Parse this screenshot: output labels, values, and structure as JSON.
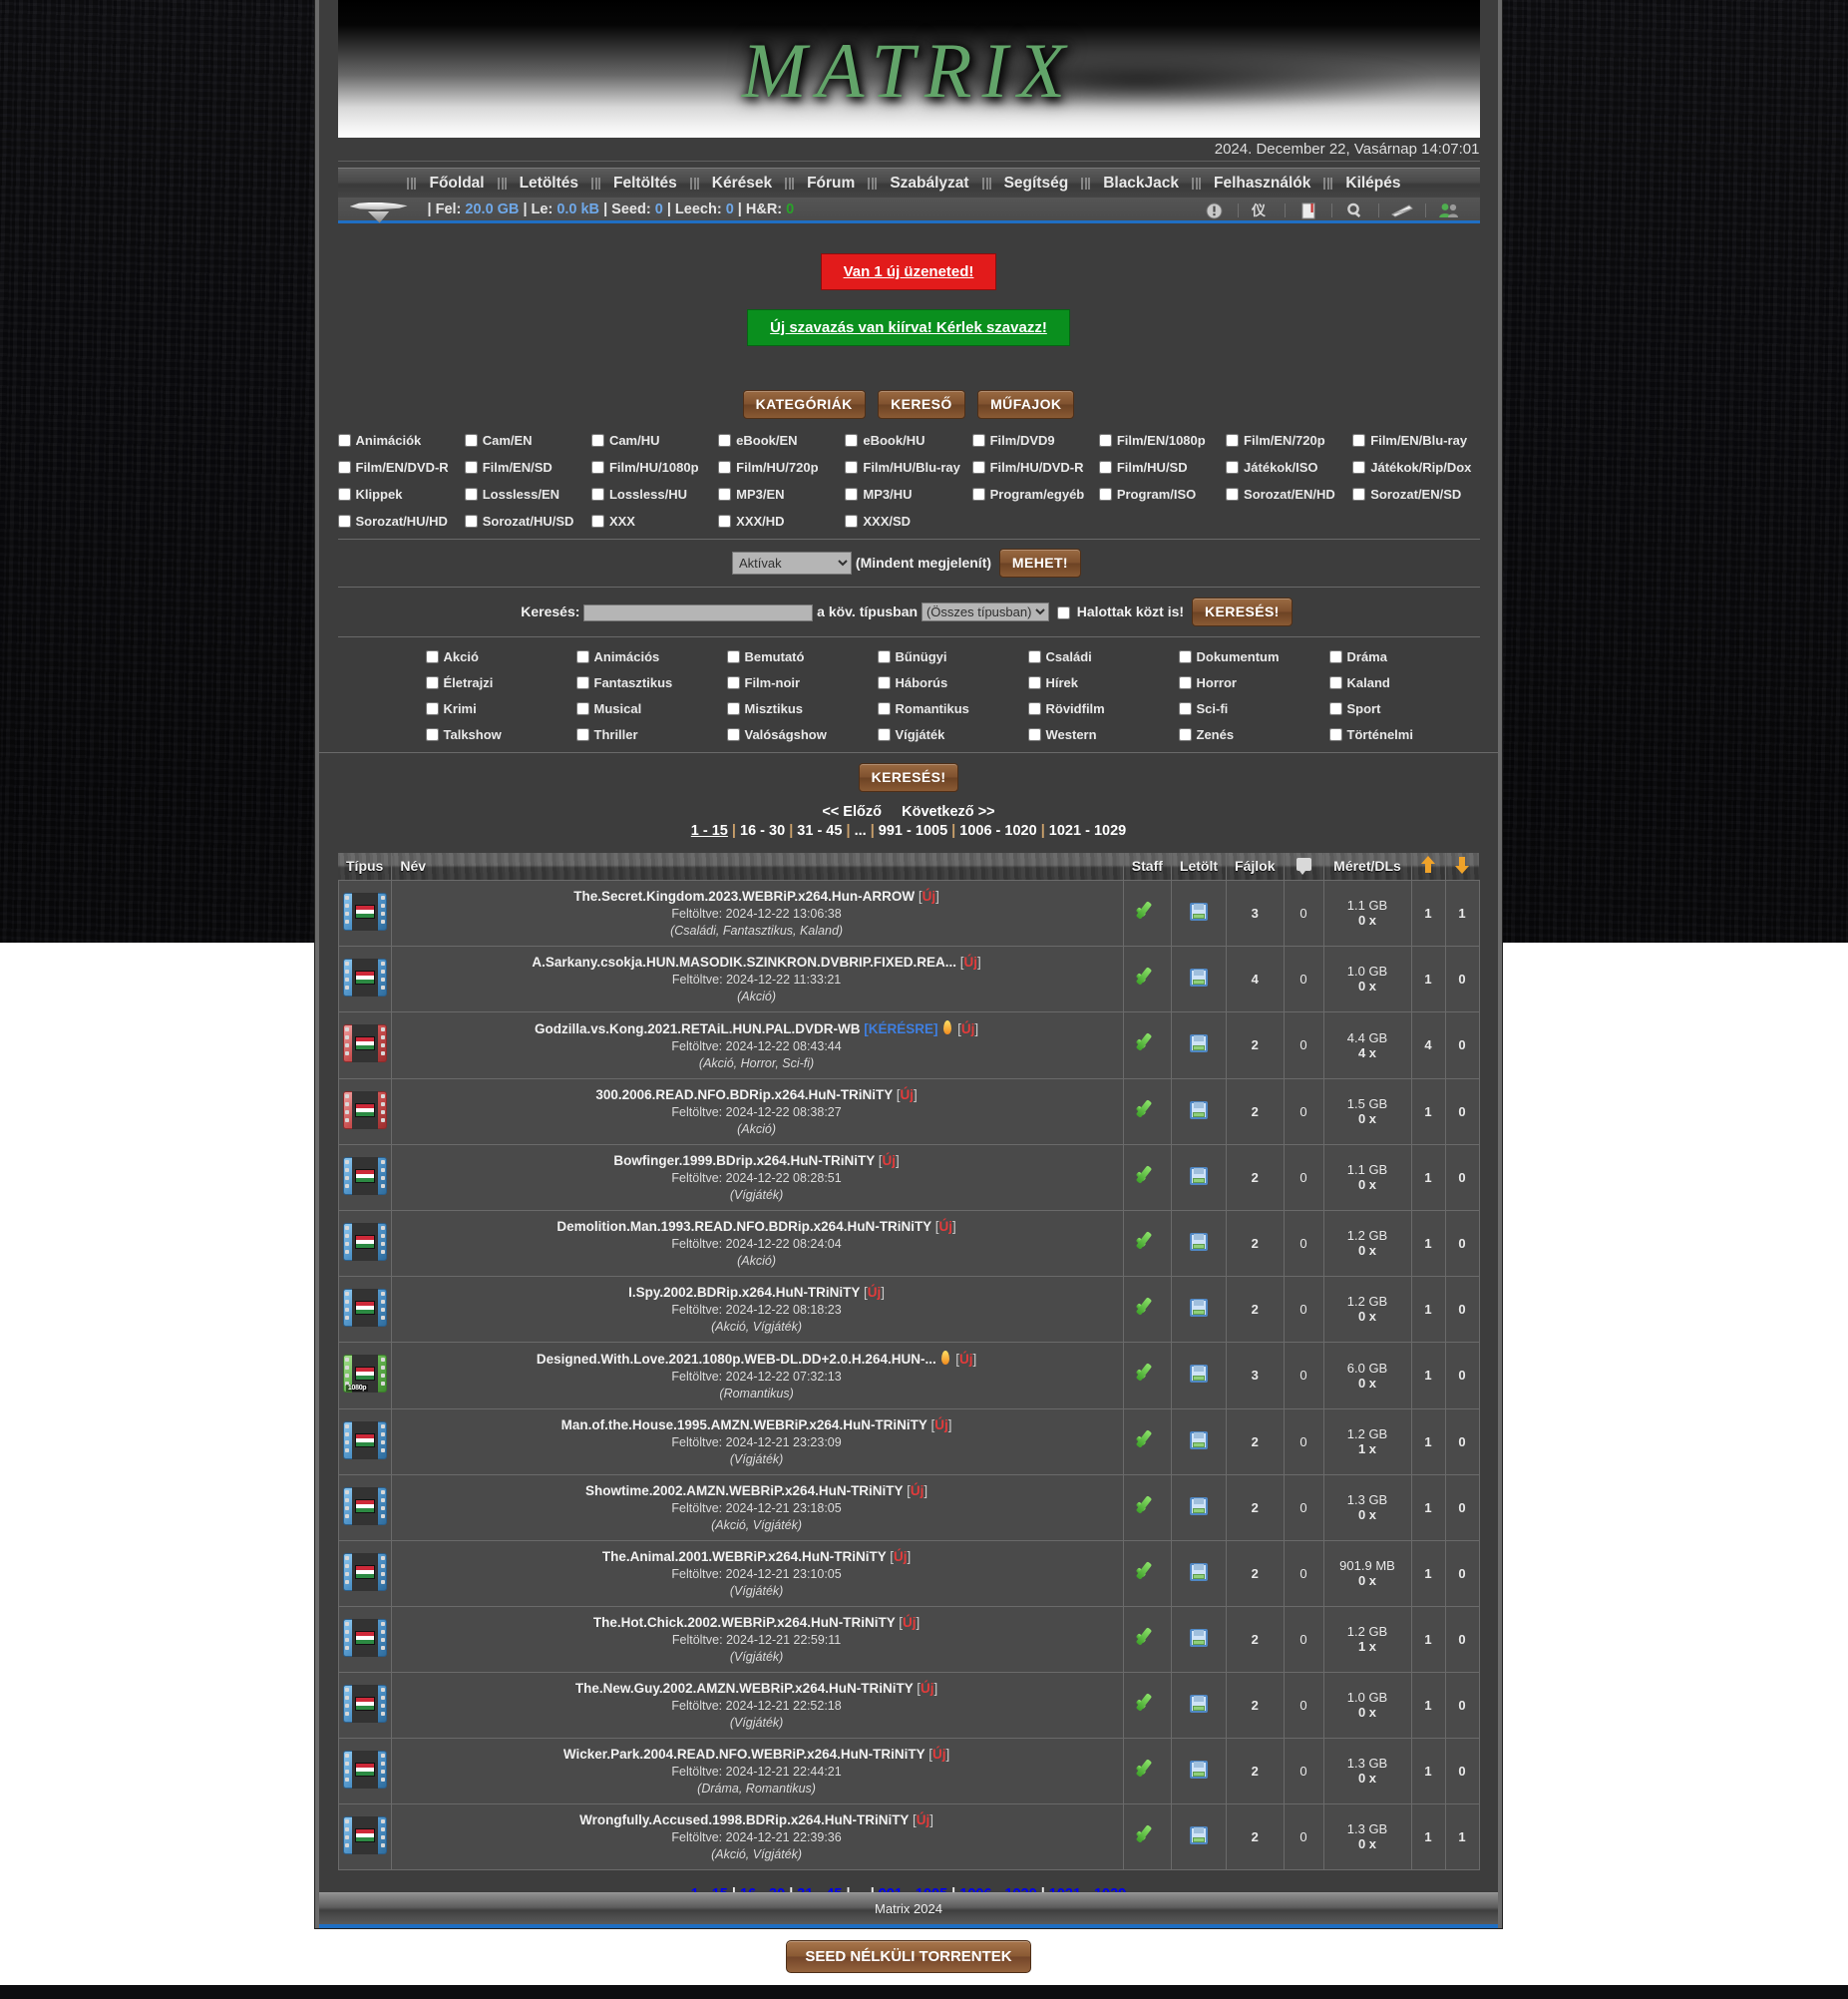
{
  "site": {
    "logo_text": "MATRIX",
    "datetime": "2024. December 22, Vasárnap 14:07:01",
    "footer": "Matrix 2024"
  },
  "nav": {
    "items": [
      {
        "label": "Főoldal"
      },
      {
        "label": "Letöltés"
      },
      {
        "label": "Feltöltés"
      },
      {
        "label": "Kérések"
      },
      {
        "label": "Fórum"
      },
      {
        "label": "Szabályzat"
      },
      {
        "label": "Segítség"
      },
      {
        "label": "BlackJack"
      },
      {
        "label": "Felhasználók"
      },
      {
        "label": "Kilépés"
      }
    ]
  },
  "stats": {
    "sep": "|",
    "upload_label": "Fel:",
    "upload_value": "20.0 GB",
    "download_label": "Le:",
    "download_value": "0.0 kB",
    "seed_label": "Seed:",
    "seed_value": "0",
    "leech_label": "Leech:",
    "leech_value": "0",
    "hr_label": "H&R:",
    "hr_value": "0",
    "icons": [
      "info-icon",
      "people-icon",
      "bookmark-icon",
      "search-icon",
      "envelope-icon",
      "users-icon"
    ]
  },
  "messages": {
    "new_pm": "Van 1 új üzeneted!",
    "new_poll": "Új szavazás van kiírva! Kérlek szavazz!"
  },
  "tabs": {
    "categories": "KATEGÓRIÁK",
    "search": "KERESŐ",
    "genres": "MŰFAJOK"
  },
  "categories": [
    "Animációk",
    "Cam/EN",
    "Cam/HU",
    "eBook/EN",
    "eBook/HU",
    "Film/DVD9",
    "Film/EN/1080p",
    "Film/EN/720p",
    "Film/EN/Blu-ray",
    "Film/EN/DVD-R",
    "Film/EN/SD",
    "Film/HU/1080p",
    "Film/HU/720p",
    "Film/HU/Blu-ray",
    "Film/HU/DVD-R",
    "Film/HU/SD",
    "Játékok/ISO",
    "Játékok/Rip/Dox",
    "Klippek",
    "Lossless/EN",
    "Lossless/HU",
    "MP3/EN",
    "MP3/HU",
    "Program/egyéb",
    "Program/ISO",
    "Sorozat/EN/HD",
    "Sorozat/EN/SD",
    "Sorozat/HU/HD",
    "Sorozat/HU/SD",
    "XXX",
    "XXX/HD",
    "XXX/SD"
  ],
  "filter": {
    "select_value": "Aktívak",
    "select_options": [
      "Aktívak"
    ],
    "show_all_label": "(Mindent megjelenít)",
    "go_button": "MEHET!"
  },
  "search": {
    "label": "Keresés:",
    "input_value": "",
    "input_placeholder": "",
    "mid_label": "a köv. típusban",
    "type_value": "(Összes típusban)",
    "type_options": [
      "(Összes típusban)"
    ],
    "dead_label": "Halottak közt is!",
    "search_button": "KERESÉS!"
  },
  "genres": [
    "Akció",
    "Animációs",
    "Bemutató",
    "Bűnügyi",
    "Családi",
    "Dokumentum",
    "Dráma",
    "Életrajzi",
    "Fantasztikus",
    "Film-noir",
    "Háborús",
    "Hírek",
    "Horror",
    "Kaland",
    "Krimi",
    "Musical",
    "Misztikus",
    "Romantikus",
    "Rövidfilm",
    "Sci-fi",
    "Sport",
    "Talkshow",
    "Thriller",
    "Valóságshow",
    "Vígjáték",
    "Western",
    "Zenés",
    "Történelmi"
  ],
  "genre_search_button": "KERESÉS!",
  "pagination": {
    "prev": "<< Előző",
    "next": "Következő >>",
    "pages": [
      "1 - 15",
      "16 - 30",
      "31 - 45",
      "...",
      "991 - 1005",
      "1006 - 1020",
      "1021 - 1029"
    ],
    "current": "1 - 15"
  },
  "table": {
    "headers": {
      "type": "Típus",
      "name": "Név",
      "staff": "Staff",
      "download": "Letölt",
      "files": "Fájlok",
      "comments": "comment-icon",
      "size": "Méret/DLs",
      "seeders": "up-arrow-icon",
      "leechers": "down-arrow-icon"
    },
    "uploaded_prefix": "Feltöltve:",
    "rows": [
      {
        "icon": "film-icon",
        "icon_variant": "blue",
        "icon_badge": "",
        "name": "The.Secret.Kingdom.2023.WEBRiP.x264.Hun-ARROW",
        "new_tag": "Új",
        "request_tag": "",
        "hot": false,
        "uploaded": "2024-12-22 13:06:38",
        "genres": "(Családi, Fantasztikus, Kaland)",
        "staff": "check-icon",
        "download": "floppy-icon",
        "files": "3",
        "comments": "0",
        "size": "1.1 GB",
        "dls": "0 x",
        "seeders": "1",
        "leechers": "1"
      },
      {
        "icon": "film-icon",
        "icon_variant": "blue",
        "icon_badge": "",
        "name": "A.Sarkany.csokja.HUN.MASODIK.SZINKRON.DVBRIP.FIXED.REA...",
        "new_tag": "Új",
        "request_tag": "",
        "hot": false,
        "uploaded": "2024-12-22 11:33:21",
        "genres": "(Akció)",
        "staff": "check-icon",
        "download": "floppy-icon",
        "files": "4",
        "comments": "0",
        "size": "1.0 GB",
        "dls": "0 x",
        "seeders": "1",
        "leechers": "0"
      },
      {
        "icon": "film-icon",
        "icon_variant": "red",
        "icon_badge": "",
        "name": "Godzilla.vs.Kong.2021.RETAiL.HUN.PAL.DVDR-WB",
        "new_tag": "Új",
        "request_tag": "[KÉRÉSRE]",
        "hot": true,
        "uploaded": "2024-12-22 08:43:44",
        "genres": "(Akció, Horror, Sci-fi)",
        "staff": "check-icon",
        "download": "floppy-icon",
        "files": "2",
        "comments": "0",
        "size": "4.4 GB",
        "dls": "4 x",
        "seeders": "4",
        "leechers": "0"
      },
      {
        "icon": "film-icon",
        "icon_variant": "red",
        "icon_badge": "",
        "name": "300.2006.READ.NFO.BDRip.x264.HuN-TRiNiTY",
        "new_tag": "Új",
        "request_tag": "",
        "hot": false,
        "uploaded": "2024-12-22 08:38:27",
        "genres": "(Akció)",
        "staff": "check-icon",
        "download": "floppy-icon",
        "files": "2",
        "comments": "0",
        "size": "1.5 GB",
        "dls": "0 x",
        "seeders": "1",
        "leechers": "0"
      },
      {
        "icon": "film-icon",
        "icon_variant": "blue",
        "icon_badge": "",
        "name": "Bowfinger.1999.BDrip.x264.HuN-TRiNiTY",
        "new_tag": "Új",
        "request_tag": "",
        "hot": false,
        "uploaded": "2024-12-22 08:28:51",
        "genres": "(Vígjáték)",
        "staff": "check-icon",
        "download": "floppy-icon",
        "files": "2",
        "comments": "0",
        "size": "1.1 GB",
        "dls": "0 x",
        "seeders": "1",
        "leechers": "0"
      },
      {
        "icon": "film-icon",
        "icon_variant": "blue",
        "icon_badge": "",
        "name": "Demolition.Man.1993.READ.NFO.BDRip.x264.HuN-TRiNiTY",
        "new_tag": "Új",
        "request_tag": "",
        "hot": false,
        "uploaded": "2024-12-22 08:24:04",
        "genres": "(Akció)",
        "staff": "check-icon",
        "download": "floppy-icon",
        "files": "2",
        "comments": "0",
        "size": "1.2 GB",
        "dls": "0 x",
        "seeders": "1",
        "leechers": "0"
      },
      {
        "icon": "film-icon",
        "icon_variant": "blue",
        "icon_badge": "",
        "name": "I.Spy.2002.BDRip.x264.HuN-TRiNiTY",
        "new_tag": "Új",
        "request_tag": "",
        "hot": false,
        "uploaded": "2024-12-22 08:18:23",
        "genres": "(Akció, Vígjáték)",
        "staff": "check-icon",
        "download": "floppy-icon",
        "files": "2",
        "comments": "0",
        "size": "1.2 GB",
        "dls": "0 x",
        "seeders": "1",
        "leechers": "0"
      },
      {
        "icon": "film-icon",
        "icon_variant": "green",
        "icon_badge": "1080p",
        "name": "Designed.With.Love.2021.1080p.WEB-DL.DD+2.0.H.264.HUN-...",
        "new_tag": "Új",
        "request_tag": "",
        "hot": true,
        "uploaded": "2024-12-22 07:32:13",
        "genres": "(Romantikus)",
        "staff": "check-icon",
        "download": "floppy-icon",
        "files": "3",
        "comments": "0",
        "size": "6.0 GB",
        "dls": "0 x",
        "seeders": "1",
        "leechers": "0"
      },
      {
        "icon": "film-icon",
        "icon_variant": "blue",
        "icon_badge": "",
        "name": "Man.of.the.House.1995.AMZN.WEBRiP.x264.HuN-TRiNiTY",
        "new_tag": "Új",
        "request_tag": "",
        "hot": false,
        "uploaded": "2024-12-21 23:23:09",
        "genres": "(Vígjáték)",
        "staff": "check-icon",
        "download": "floppy-icon",
        "files": "2",
        "comments": "0",
        "size": "1.2 GB",
        "dls": "1 x",
        "seeders": "1",
        "leechers": "0"
      },
      {
        "icon": "film-icon",
        "icon_variant": "blue",
        "icon_badge": "",
        "name": "Showtime.2002.AMZN.WEBRiP.x264.HuN-TRiNiTY",
        "new_tag": "Új",
        "request_tag": "",
        "hot": false,
        "uploaded": "2024-12-21 23:18:05",
        "genres": "(Akció, Vígjáték)",
        "staff": "check-icon",
        "download": "floppy-icon",
        "files": "2",
        "comments": "0",
        "size": "1.3 GB",
        "dls": "0 x",
        "seeders": "1",
        "leechers": "0"
      },
      {
        "icon": "film-icon",
        "icon_variant": "blue",
        "icon_badge": "",
        "name": "The.Animal.2001.WEBRiP.x264.HuN-TRiNiTY",
        "new_tag": "Új",
        "request_tag": "",
        "hot": false,
        "uploaded": "2024-12-21 23:10:05",
        "genres": "(Vígjáték)",
        "staff": "check-icon",
        "download": "floppy-icon",
        "files": "2",
        "comments": "0",
        "size": "901.9 MB",
        "dls": "0 x",
        "seeders": "1",
        "leechers": "0"
      },
      {
        "icon": "film-icon",
        "icon_variant": "blue",
        "icon_badge": "",
        "name": "The.Hot.Chick.2002.WEBRiP.x264.HuN-TRiNiTY",
        "new_tag": "Új",
        "request_tag": "",
        "hot": false,
        "uploaded": "2024-12-21 22:59:11",
        "genres": "(Vígjáték)",
        "staff": "check-icon",
        "download": "floppy-icon",
        "files": "2",
        "comments": "0",
        "size": "1.2 GB",
        "dls": "1 x",
        "seeders": "1",
        "leechers": "0"
      },
      {
        "icon": "film-icon",
        "icon_variant": "blue",
        "icon_badge": "",
        "name": "The.New.Guy.2002.AMZN.WEBRiP.x264.HuN-TRiNiTY",
        "new_tag": "Új",
        "request_tag": "",
        "hot": false,
        "uploaded": "2024-12-21 22:52:18",
        "genres": "(Vígjáték)",
        "staff": "check-icon",
        "download": "floppy-icon",
        "files": "2",
        "comments": "0",
        "size": "1.0 GB",
        "dls": "0 x",
        "seeders": "1",
        "leechers": "0"
      },
      {
        "icon": "film-icon",
        "icon_variant": "blue",
        "icon_badge": "",
        "name": "Wicker.Park.2004.READ.NFO.WEBRiP.x264.HuN-TRiNiTY",
        "new_tag": "Új",
        "request_tag": "",
        "hot": false,
        "uploaded": "2024-12-21 22:44:21",
        "genres": "(Dráma, Romantikus)",
        "staff": "check-icon",
        "download": "floppy-icon",
        "files": "2",
        "comments": "0",
        "size": "1.3 GB",
        "dls": "0 x",
        "seeders": "1",
        "leechers": "0"
      },
      {
        "icon": "film-icon",
        "icon_variant": "blue",
        "icon_badge": "",
        "name": "Wrongfully.Accused.1998.BDRip.x264.HuN-TRiNiTY",
        "new_tag": "Új",
        "request_tag": "",
        "hot": false,
        "uploaded": "2024-12-21 22:39:36",
        "genres": "(Akció, Vígjáték)",
        "staff": "check-icon",
        "download": "floppy-icon",
        "files": "2",
        "comments": "0",
        "size": "1.3 GB",
        "dls": "0 x",
        "seeders": "1",
        "leechers": "1"
      }
    ]
  },
  "bottom": {
    "seed_button": "SEED NÉLKÜLI TORRENTEK"
  }
}
